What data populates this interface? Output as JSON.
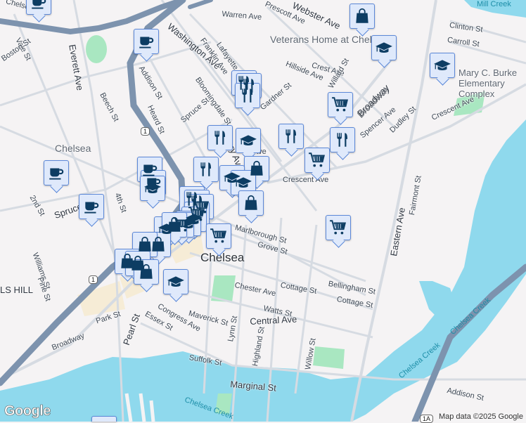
{
  "map": {
    "labels": [
      {
        "text": "Chelsea",
        "cls": ""
      },
      {
        "text": "Vale St",
        "cls": ""
      },
      {
        "text": "Boston St",
        "cls": ""
      },
      {
        "text": "Everett Ave",
        "cls": "big"
      },
      {
        "text": "Beech St",
        "cls": ""
      },
      {
        "text": "Addison St",
        "cls": ""
      },
      {
        "text": "Washington Ave",
        "cls": "big"
      },
      {
        "text": "Franklin Ave",
        "cls": ""
      },
      {
        "text": "Lafayette Ave",
        "cls": ""
      },
      {
        "text": "Warren Ave",
        "cls": ""
      },
      {
        "text": "Prescott Ave",
        "cls": ""
      },
      {
        "text": "Webster Ave",
        "cls": "big"
      },
      {
        "text": "Veterans Home at Chelsea",
        "cls": "poi"
      },
      {
        "text": "Bloomingdale St",
        "cls": ""
      },
      {
        "text": "Heard St",
        "cls": ""
      },
      {
        "text": "Spruce St",
        "cls": ""
      },
      {
        "text": "Gardner St",
        "cls": ""
      },
      {
        "text": "Cary Ave",
        "cls": "big"
      },
      {
        "text": "Crest Ave",
        "cls": ""
      },
      {
        "text": "Hillside Ave",
        "cls": ""
      },
      {
        "text": "Willard St",
        "cls": ""
      },
      {
        "text": "Broadway",
        "cls": "big"
      },
      {
        "text": "Spencer Ave",
        "cls": ""
      },
      {
        "text": "Dudley St",
        "cls": ""
      },
      {
        "text": "Clinton St",
        "cls": ""
      },
      {
        "text": "Carroll St",
        "cls": ""
      },
      {
        "text": "Mary C. Burke Elementary Complex",
        "cls": "poi"
      },
      {
        "text": "Crescent Ave",
        "cls": ""
      },
      {
        "text": "Crescent Ave",
        "cls": ""
      },
      {
        "text": "Chelsea",
        "cls": "poi"
      },
      {
        "text": "2nd St",
        "cls": ""
      },
      {
        "text": "Spruce",
        "cls": "big"
      },
      {
        "text": "4th St",
        "cls": ""
      },
      {
        "text": "Williams St",
        "cls": ""
      },
      {
        "text": "Pine St",
        "cls": ""
      },
      {
        "text": "LS HILL",
        "cls": "big"
      },
      {
        "text": "Park St",
        "cls": ""
      },
      {
        "text": "Broadway",
        "cls": ""
      },
      {
        "text": "Pearl St",
        "cls": "big"
      },
      {
        "text": "Essex St",
        "cls": ""
      },
      {
        "text": "Congress Ave",
        "cls": ""
      },
      {
        "text": "Maverick St",
        "cls": ""
      },
      {
        "text": "Lynn St",
        "cls": ""
      },
      {
        "text": "Highland St",
        "cls": ""
      },
      {
        "text": "Suffolk St",
        "cls": ""
      },
      {
        "text": "Marginal St",
        "cls": "big"
      },
      {
        "text": "Chelsea",
        "cls": "city"
      },
      {
        "text": "Chester Ave",
        "cls": ""
      },
      {
        "text": "Central Ave",
        "cls": "big"
      },
      {
        "text": "Watts St",
        "cls": ""
      },
      {
        "text": "Cottage St",
        "cls": ""
      },
      {
        "text": "Cottage St",
        "cls": ""
      },
      {
        "text": "Bellingham St",
        "cls": ""
      },
      {
        "text": "Grove St",
        "cls": ""
      },
      {
        "text": "Marlborough St",
        "cls": ""
      },
      {
        "text": "Willow St",
        "cls": ""
      },
      {
        "text": "Eastern Ave",
        "cls": "big"
      },
      {
        "text": "Chelsea Creek",
        "cls": "water"
      },
      {
        "text": "Chelsea Creek",
        "cls": "water"
      },
      {
        "text": "Chelsea Creek",
        "cls": "water"
      },
      {
        "text": "Addison St",
        "cls": ""
      },
      {
        "text": "Mill Creek",
        "cls": "water"
      },
      {
        "text": "Broadway",
        "cls": "big"
      },
      {
        "text": "Fairmont St",
        "cls": ""
      },
      {
        "text": "Ave",
        "cls": ""
      }
    ],
    "route_shields": [
      "1",
      "1",
      "1A"
    ],
    "markers": [
      "coffee",
      "coffee",
      "shopping",
      "education",
      "education",
      "restaurant",
      "restaurant",
      "restaurant",
      "cart",
      "restaurant",
      "restaurant",
      "cart",
      "restaurant",
      "education",
      "shopping",
      "restaurant",
      "education",
      "education",
      "shopping",
      "coffee",
      "coffee",
      "coffee",
      "coffee",
      "education",
      "restaurant",
      "restaurant",
      "cart",
      "cart",
      "education",
      "education",
      "cart",
      "cart",
      "education",
      "shopping",
      "shopping",
      "cart",
      "shopping",
      "shopping",
      "shopping",
      "education",
      "coffee"
    ],
    "colors": {
      "water": "#8fd9ed",
      "highway": "#7d93ae",
      "park": "#a9e7c1",
      "road": "#d6dbe2",
      "icon": "#0d3d63"
    },
    "attribution": "Map data ©2025 Google",
    "google_logo": "Google"
  }
}
